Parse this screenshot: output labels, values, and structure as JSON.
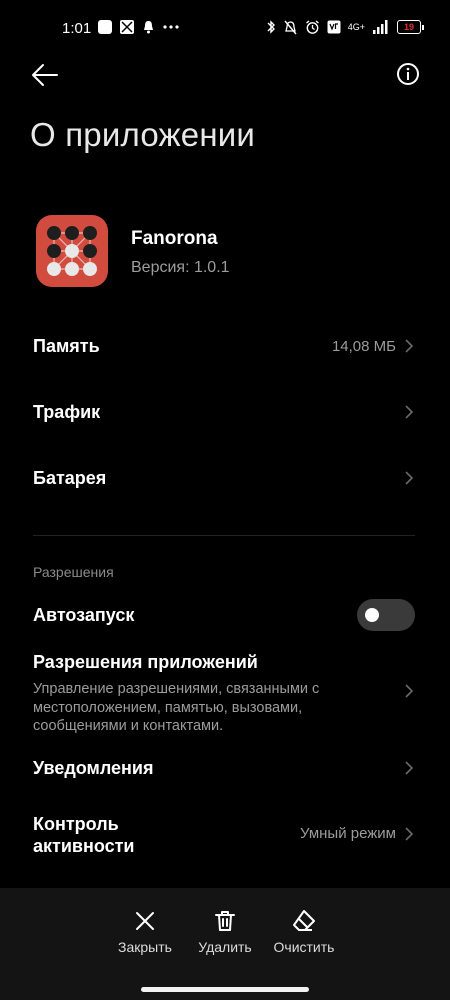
{
  "status_bar": {
    "time": "1:01",
    "network": "4G+",
    "battery_level": "19"
  },
  "header": {
    "title": "О приложении",
    "back_icon": "arrow-left-icon",
    "info_icon": "info-icon"
  },
  "app": {
    "name": "Fanorona",
    "version": "Версия: 1.0.1"
  },
  "rows": {
    "memory": {
      "label": "Память",
      "value": "14,08 МБ"
    },
    "traffic": {
      "label": "Трафик"
    },
    "battery": {
      "label": "Батарея"
    }
  },
  "permissions_section": {
    "label": "Разрешения",
    "autostart": {
      "label": "Автозапуск",
      "enabled": false
    },
    "app_permissions": {
      "label": "Разрешения приложений",
      "description": "Управление разрешениями, связанными с местоположением, памятью, вызовами, сообщениями и контактами."
    },
    "notifications": {
      "label": "Уведомления"
    },
    "activity_control": {
      "label": "Контроль активности",
      "value": "Умный режим"
    }
  },
  "bottom_bar": {
    "close": "Закрыть",
    "delete": "Удалить",
    "clear": "Очистить"
  },
  "colors": {
    "background": "#000000",
    "secondary_text": "#9c9c9c",
    "app_icon_bg": "#d14b3f",
    "bottom_bar_bg": "#141414"
  }
}
